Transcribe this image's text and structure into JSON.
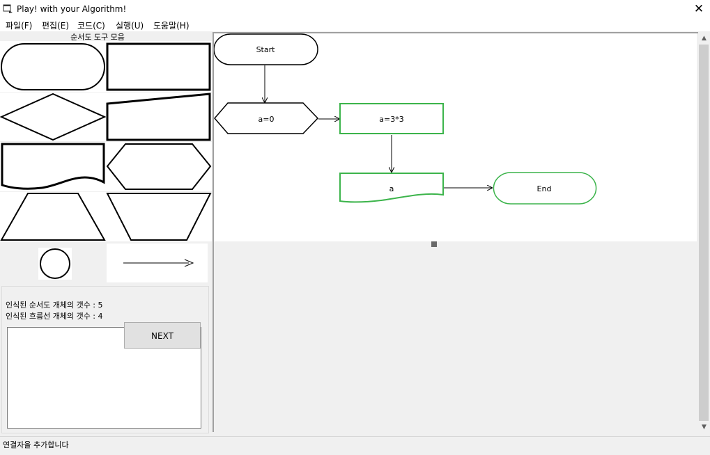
{
  "window": {
    "title": "Play! with your Algorithm!"
  },
  "menu": [
    {
      "label": "파일(F)"
    },
    {
      "label": "편집(E)"
    },
    {
      "label": "코드(C)"
    },
    {
      "label": "실행(U)"
    },
    {
      "label": "도움말(H)"
    }
  ],
  "toolbox": {
    "title": "순서도 도구 모음",
    "tools": [
      {
        "name": "terminal-tool"
      },
      {
        "name": "process-tool"
      },
      {
        "name": "decision-tool"
      },
      {
        "name": "manual-input-tool"
      },
      {
        "name": "document-tool"
      },
      {
        "name": "preparation-tool"
      },
      {
        "name": "trapezoid-tool"
      },
      {
        "name": "manual-operation-tool"
      },
      {
        "name": "connector-tool"
      },
      {
        "name": "arrow-tool"
      }
    ]
  },
  "info": {
    "shape_count": "인식된 순서도 개체의 갯수 : 5",
    "line_count": "인식된 흐름선 개체의 갯수 : 4",
    "next_label": "NEXT"
  },
  "flowchart": {
    "nodes": [
      {
        "id": "start",
        "type": "terminal",
        "label": "Start",
        "color": "#000000"
      },
      {
        "id": "init",
        "type": "preparation",
        "label": "a=0",
        "color": "#000000"
      },
      {
        "id": "assign",
        "type": "process",
        "label": "a=3*3",
        "color": "#3cb44b"
      },
      {
        "id": "output",
        "type": "document",
        "label": "a",
        "color": "#3cb44b"
      },
      {
        "id": "end",
        "type": "terminal",
        "label": "End",
        "color": "#3cb44b"
      }
    ],
    "edges": [
      {
        "from": "start",
        "to": "init"
      },
      {
        "from": "init",
        "to": "assign"
      },
      {
        "from": "assign",
        "to": "output"
      },
      {
        "from": "output",
        "to": "end"
      }
    ]
  },
  "status": {
    "text": "연결자을 추가합니다"
  },
  "colors": {
    "highlight": "#3cb44b",
    "window_bg": "#f0f0f0"
  }
}
